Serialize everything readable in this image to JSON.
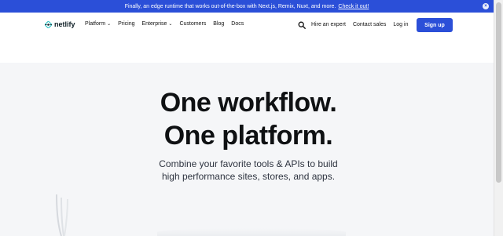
{
  "announcement": {
    "text": "Finally, an edge runtime that works out-of-the-box with Next.js, Remix, Nuxt, and more.",
    "link": "Check it out!",
    "close_glyph": "×"
  },
  "logo": {
    "text": "netlify",
    "icon": "netlify-logo-icon"
  },
  "nav": {
    "items": [
      {
        "label": "Platform",
        "has_dropdown": true
      },
      {
        "label": "Pricing",
        "has_dropdown": false
      },
      {
        "label": "Enterprise",
        "has_dropdown": true
      },
      {
        "label": "Customers",
        "has_dropdown": false
      },
      {
        "label": "Blog",
        "has_dropdown": false
      },
      {
        "label": "Docs",
        "has_dropdown": false
      }
    ],
    "chevron": "⌄"
  },
  "right_nav": {
    "search_icon": "search-icon",
    "hire": "Hire an expert",
    "contact": "Contact sales",
    "login": "Log in",
    "signup": "Sign up"
  },
  "hero": {
    "line1": "One workflow.",
    "line2": "One platform.",
    "sub1": "Combine your favorite tools & APIs to build",
    "sub2": "high performance sites, stores, and apps."
  },
  "colors": {
    "accent": "#2b4fd8",
    "background": "#f5f6f8",
    "teal": "#32c1c4"
  }
}
